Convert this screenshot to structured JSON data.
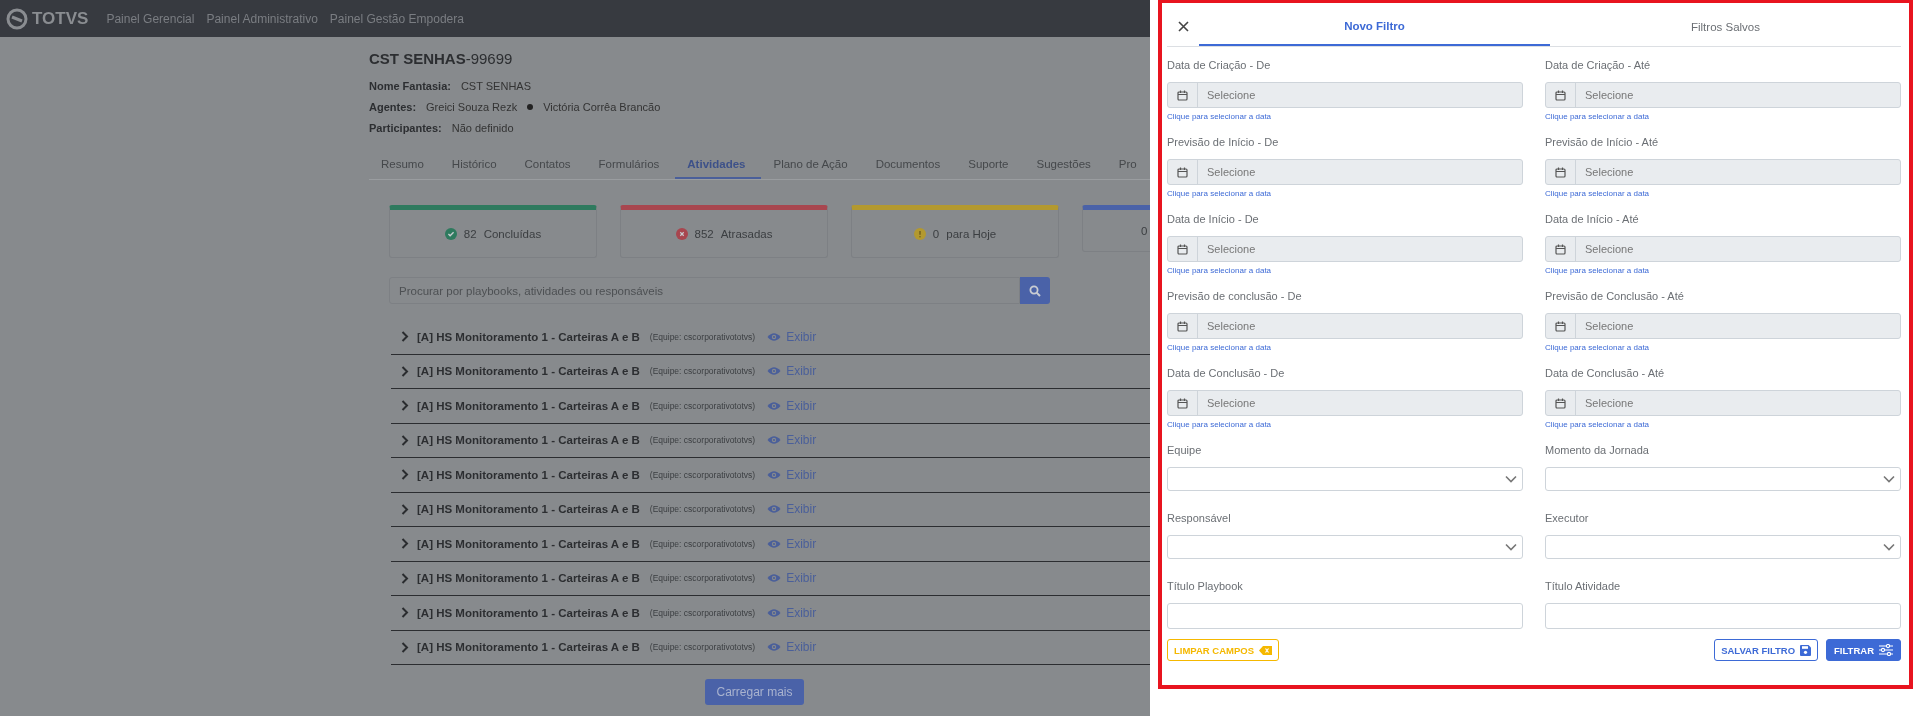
{
  "header": {
    "logo": "TOTVS",
    "nav": [
      "Painel Gerencial",
      "Painel Administrativo",
      "Painel Gestão Empodera"
    ]
  },
  "account": {
    "name": "CST SENHAS",
    "code": "-99699",
    "details": [
      {
        "label": "Nome Fantasia:",
        "values": [
          "CST SENHAS"
        ]
      },
      {
        "label": "Agentes:",
        "values": [
          "Greici Souza Rezk",
          "Victória Corrêa Brancão"
        ]
      },
      {
        "label": "Participantes:",
        "values": [
          "Não definido"
        ]
      }
    ]
  },
  "tabs": [
    {
      "label": "Resumo",
      "selected": false
    },
    {
      "label": "Histórico",
      "selected": false
    },
    {
      "label": "Contatos",
      "selected": false
    },
    {
      "label": "Formulários",
      "selected": false
    },
    {
      "label": "Atividades",
      "selected": true
    },
    {
      "label": "Plano de Ação",
      "selected": false
    },
    {
      "label": "Documentos",
      "selected": false
    },
    {
      "label": "Suporte",
      "selected": false
    },
    {
      "label": "Sugestões",
      "selected": false
    },
    {
      "label": "Pro",
      "selected": false
    }
  ],
  "stats": [
    {
      "kind": "done",
      "value": "82",
      "label": "Concluídas",
      "color": "#2e7a5e"
    },
    {
      "kind": "late",
      "value": "852",
      "label": "Atrasadas",
      "color": "#a8464f"
    },
    {
      "kind": "today",
      "value": "0",
      "label": "para Hoje",
      "color": "#b3992f"
    },
    {
      "kind": "other",
      "value": "0",
      "color": "#4a62a8"
    }
  ],
  "search": {
    "placeholder": "Procurar por playbooks, atividades ou responsáveis"
  },
  "playbooks": [
    {
      "title": "[A] HS Monitoramento 1 - Carteiras A e B",
      "team": "(Equipe: cscorporativototvs)",
      "action": "Exibir"
    },
    {
      "title": "[A] HS Monitoramento 1 - Carteiras A e B",
      "team": "(Equipe: cscorporativototvs)",
      "action": "Exibir"
    },
    {
      "title": "[A] HS Monitoramento 1 - Carteiras A e B",
      "team": "(Equipe: cscorporativototvs)",
      "action": "Exibir"
    },
    {
      "title": "[A] HS Monitoramento 1 - Carteiras A e B",
      "team": "(Equipe: cscorporativototvs)",
      "action": "Exibir"
    },
    {
      "title": "[A] HS Monitoramento 1 - Carteiras A e B",
      "team": "(Equipe: cscorporativototvs)",
      "action": "Exibir"
    },
    {
      "title": "[A] HS Monitoramento 1 - Carteiras A e B",
      "team": "(Equipe: cscorporativototvs)",
      "action": "Exibir"
    },
    {
      "title": "[A] HS Monitoramento 1 - Carteiras A e B",
      "team": "(Equipe: cscorporativototvs)",
      "action": "Exibir"
    },
    {
      "title": "[A] HS Monitoramento 1 - Carteiras A e B",
      "team": "(Equipe: cscorporativototvs)",
      "action": "Exibir"
    },
    {
      "title": "[A] HS Monitoramento 1 - Carteiras A e B",
      "team": "(Equipe: cscorporativototvs)",
      "action": "Exibir"
    },
    {
      "title": "[A] HS Monitoramento 1 - Carteiras A e B",
      "team": "(Equipe: cscorporativototvs)",
      "action": "Exibir"
    }
  ],
  "load_more": "Carregar mais",
  "filter_panel": {
    "tabs": [
      {
        "label": "Novo Filtro",
        "selected": true
      },
      {
        "label": "Filtros Salvos",
        "selected": false
      }
    ],
    "fields": [
      {
        "kind": "date",
        "label": "Data de Criação - De",
        "placeholder": "Selecione",
        "hint": "Clique para selecionar a data"
      },
      {
        "kind": "date",
        "label": "Data de Criação - Até",
        "placeholder": "Selecione",
        "hint": "Clique para selecionar a data"
      },
      {
        "kind": "date",
        "label": "Previsão de Início - De",
        "placeholder": "Selecione",
        "hint": "Clique para selecionar a data"
      },
      {
        "kind": "date",
        "label": "Previsão de Início - Até",
        "placeholder": "Selecione",
        "hint": "Clique para selecionar a data"
      },
      {
        "kind": "date",
        "label": "Data de Início - De",
        "placeholder": "Selecione",
        "hint": "Clique para selecionar a data"
      },
      {
        "kind": "date",
        "label": "Data de Início - Até",
        "placeholder": "Selecione",
        "hint": "Clique para selecionar a data"
      },
      {
        "kind": "date",
        "label": "Previsão de conclusão - De",
        "placeholder": "Selecione",
        "hint": "Clique para selecionar a data"
      },
      {
        "kind": "date",
        "label": "Previsão de Conclusão - Até",
        "placeholder": "Selecione",
        "hint": "Clique para selecionar a data"
      },
      {
        "kind": "date",
        "label": "Data de Conclusão - De",
        "placeholder": "Selecione",
        "hint": "Clique para selecionar a data"
      },
      {
        "kind": "date",
        "label": "Data de Conclusão - Até",
        "placeholder": "Selecione",
        "hint": "Clique para selecionar a data"
      },
      {
        "kind": "select",
        "label": "Equipe"
      },
      {
        "kind": "select",
        "label": "Momento da Jornada"
      },
      {
        "kind": "select",
        "label": "Responsável"
      },
      {
        "kind": "select",
        "label": "Executor"
      },
      {
        "kind": "text",
        "label": "Título Playbook"
      },
      {
        "kind": "text",
        "label": "Título Atividade"
      }
    ],
    "buttons": [
      {
        "kind": "clear",
        "label": "LIMPAR CAMPOS"
      },
      {
        "kind": "save",
        "label": "SALVAR FILTRO"
      },
      {
        "kind": "filter",
        "label": "FILTRAR"
      }
    ]
  }
}
